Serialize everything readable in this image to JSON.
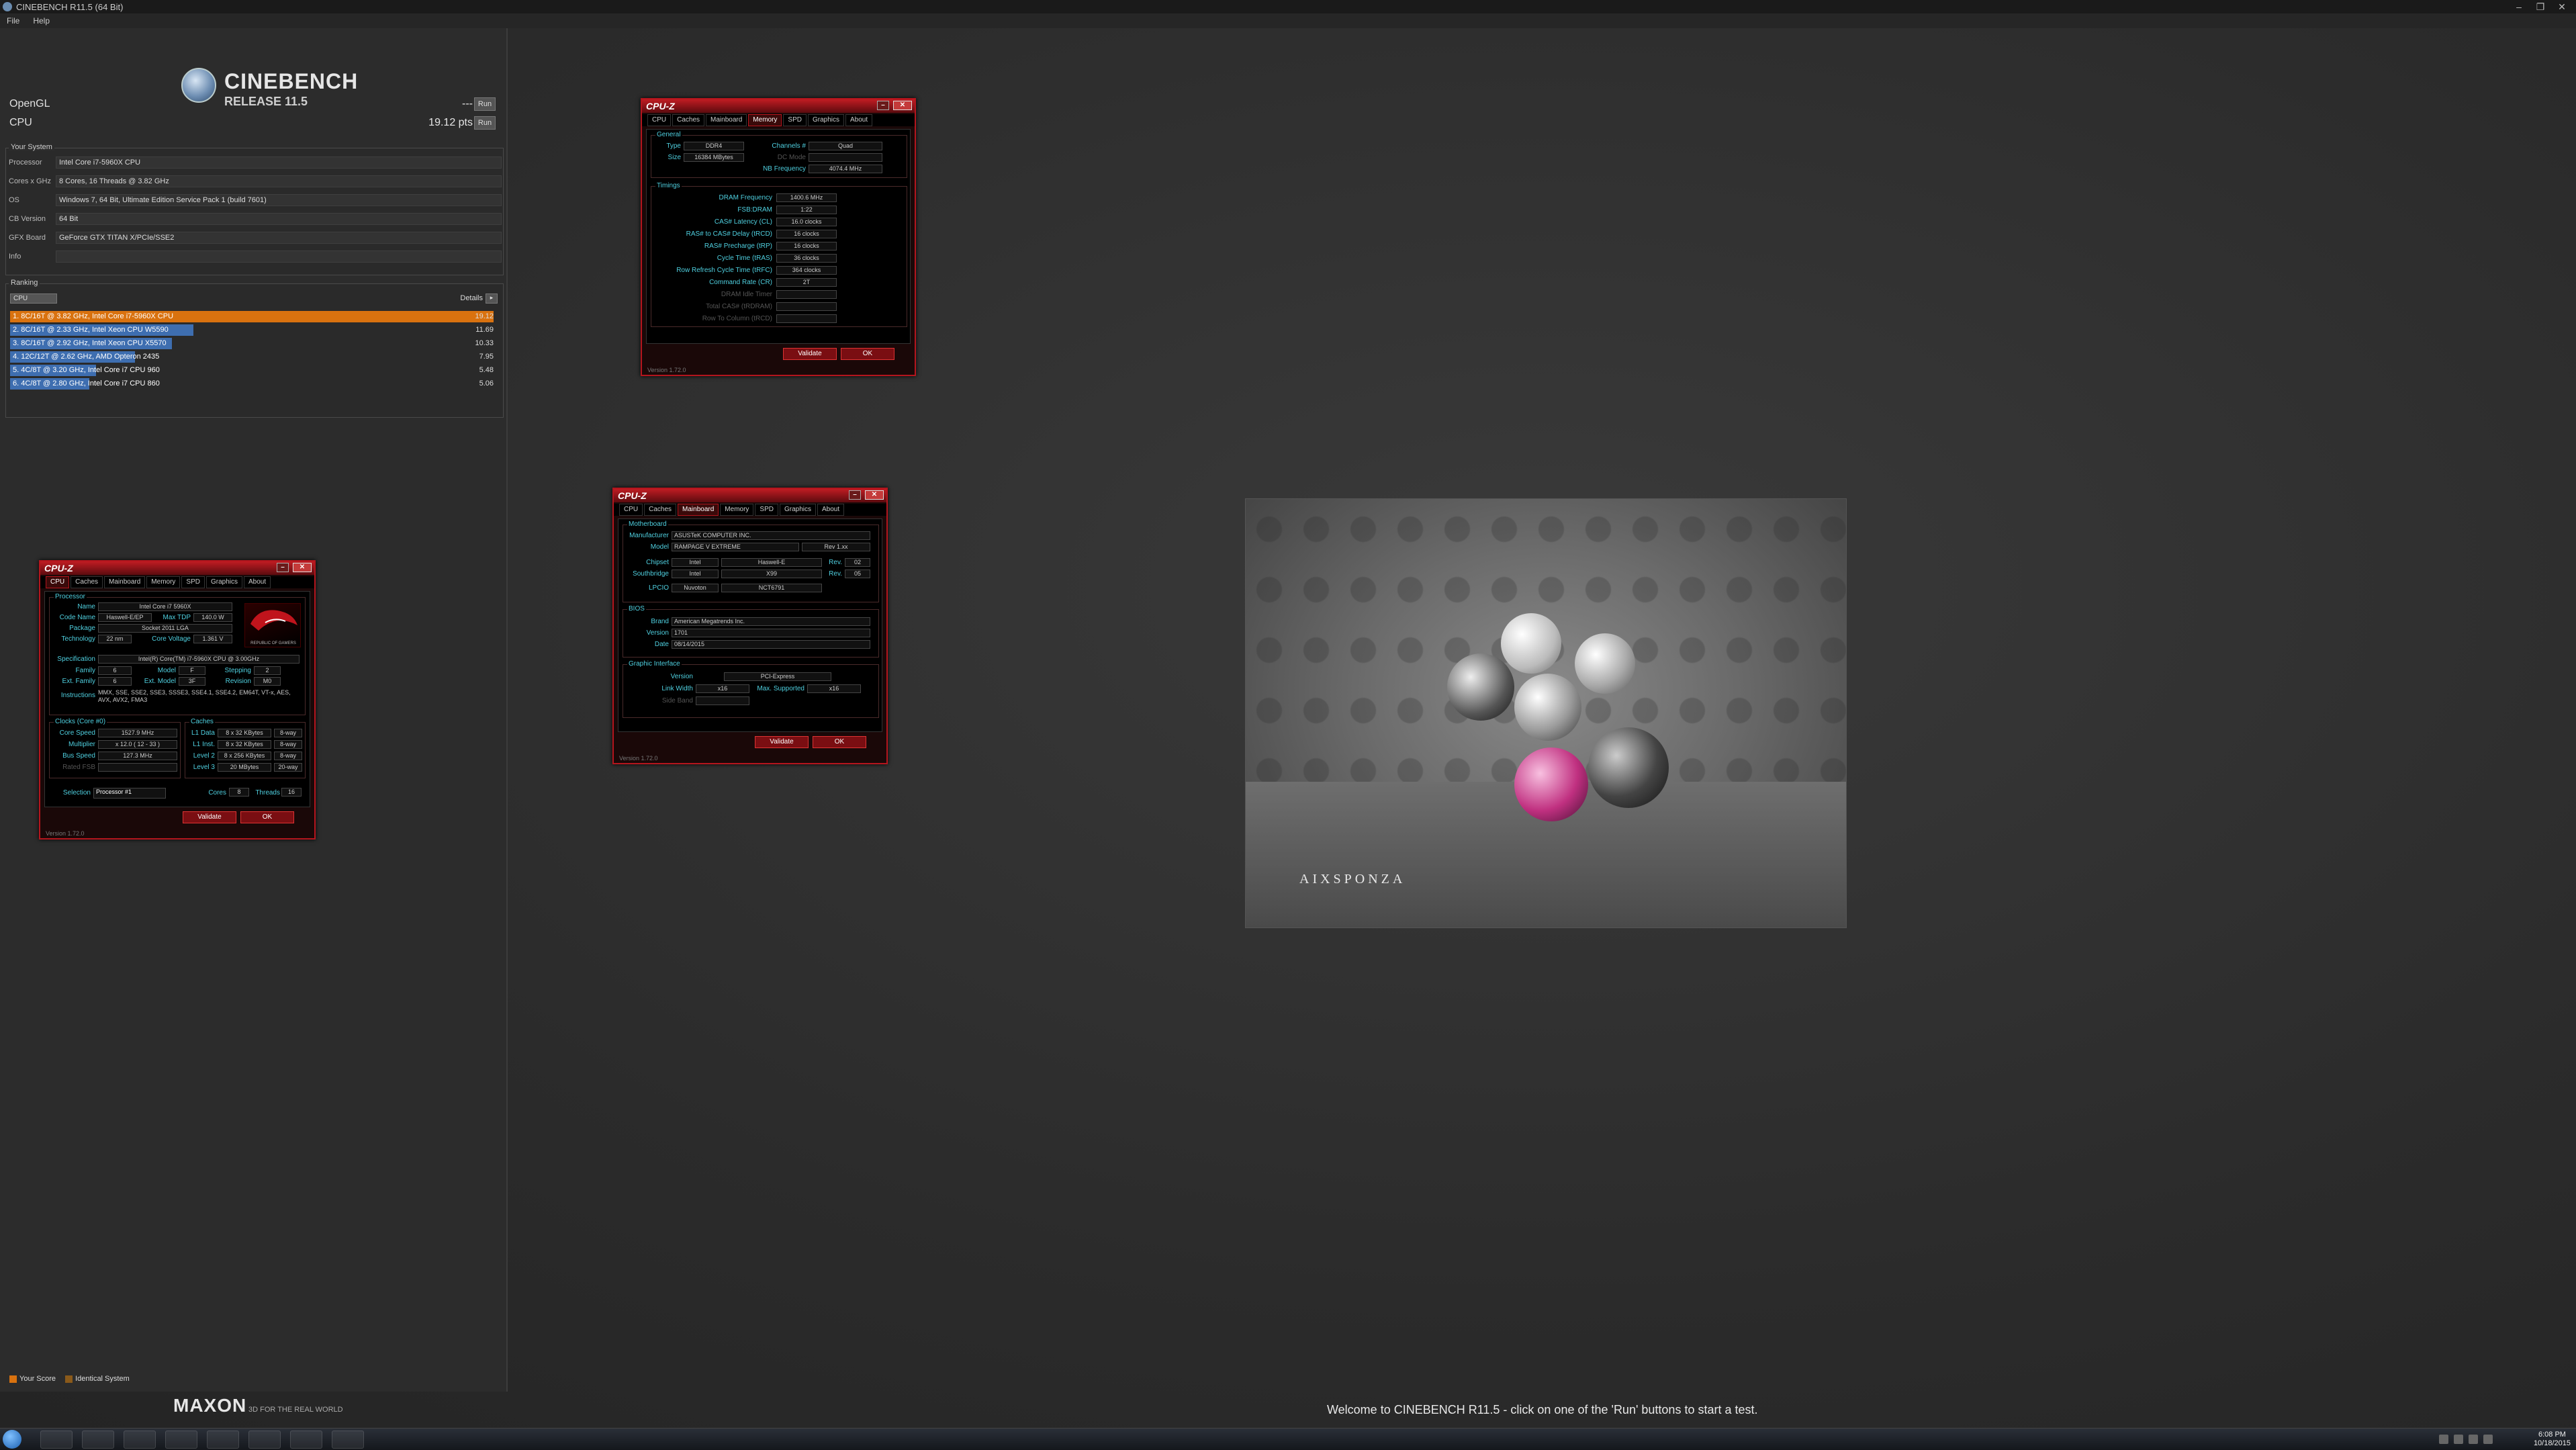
{
  "window": {
    "title": "CINEBENCH R11.5 (64 Bit)",
    "min": "–",
    "max": "❐",
    "close": "✕"
  },
  "menu": {
    "file": "File",
    "help": "Help"
  },
  "logo": {
    "name": "CINEBENCH",
    "release": "RELEASE 11.5"
  },
  "scores": {
    "opengl_label": "OpenGL",
    "opengl_value": "---",
    "opengl_run": "Run",
    "cpu_label": "CPU",
    "cpu_value": "19.12 pts",
    "cpu_run": "Run"
  },
  "your_system": {
    "header": "Your System",
    "rows": [
      {
        "k": "Processor",
        "v": "Intel Core i7-5960X CPU"
      },
      {
        "k": "Cores x GHz",
        "v": "8 Cores, 16 Threads @ 3.82 GHz"
      },
      {
        "k": "OS",
        "v": "Windows 7, 64 Bit, Ultimate Edition Service Pack 1 (build 7601)"
      },
      {
        "k": "CB Version",
        "v": "64 Bit"
      },
      {
        "k": "GFX Board",
        "v": "GeForce GTX TITAN X/PCIe/SSE2"
      },
      {
        "k": "Info",
        "v": ""
      }
    ]
  },
  "ranking": {
    "header": "Ranking",
    "filter": "CPU",
    "details": "Details",
    "entries": [
      {
        "label": "1. 8C/16T @ 3.82 GHz, Intel Core i7-5960X CPU",
        "score": "19.12",
        "frac": 1.0,
        "color": "#d9720f"
      },
      {
        "label": "2. 8C/16T @ 2.33 GHz, Intel Xeon CPU W5590",
        "score": "11.69",
        "frac": 0.611,
        "color": "#3e6eb0"
      },
      {
        "label": "3. 8C/16T @ 2.92 GHz, Intel Xeon CPU X5570",
        "score": "10.33",
        "frac": 0.54,
        "color": "#3e6eb0"
      },
      {
        "label": "4. 12C/12T @ 2.62 GHz, AMD Opteron 2435",
        "score": "7.95",
        "frac": 0.416,
        "color": "#3e6eb0"
      },
      {
        "label": "5. 4C/8T @ 3.20 GHz, Intel Core i7 CPU 960",
        "score": "5.48",
        "frac": 0.287,
        "color": "#3e6eb0"
      },
      {
        "label": "6. 4C/8T @ 2.80 GHz, Intel Core i7 CPU 860",
        "score": "5.06",
        "frac": 0.265,
        "color": "#3e6eb0"
      }
    ]
  },
  "legend": {
    "your_score": "Your Score",
    "identical": "Identical System",
    "your_color": "#d9720f",
    "identical_color": "#8a5a1a"
  },
  "footer": {
    "maxon": "MAXON",
    "tagline": "3D FOR THE REAL WORLD",
    "status": "Welcome to CINEBENCH R11.5 - click on one of the 'Run' buttons to start a test."
  },
  "render": {
    "brand": "AIXSPONZA"
  },
  "cpuz_memory": {
    "title": "CPU-Z",
    "tabs": [
      "CPU",
      "Caches",
      "Mainboard",
      "Memory",
      "SPD",
      "Graphics",
      "About"
    ],
    "general": "General",
    "type_k": "Type",
    "type_v": "DDR4",
    "size_k": "Size",
    "size_v": "16384 MBytes",
    "channels_k": "Channels #",
    "channels_v": "Quad",
    "dc_k": "DC Mode",
    "nb_k": "NB Frequency",
    "nb_v": "4074.4 MHz",
    "timings": "Timings",
    "rows": [
      {
        "k": "DRAM Frequency",
        "v": "1400.6 MHz"
      },
      {
        "k": "FSB:DRAM",
        "v": "1:22"
      },
      {
        "k": "CAS# Latency (CL)",
        "v": "16.0 clocks"
      },
      {
        "k": "RAS# to CAS# Delay (tRCD)",
        "v": "16 clocks"
      },
      {
        "k": "RAS# Precharge (tRP)",
        "v": "16 clocks"
      },
      {
        "k": "Cycle Time (tRAS)",
        "v": "36 clocks"
      },
      {
        "k": "Row Refresh Cycle Time (tRFC)",
        "v": "364 clocks"
      },
      {
        "k": "Command Rate (CR)",
        "v": "2T"
      },
      {
        "k": "DRAM Idle Timer",
        "v": ""
      },
      {
        "k": "Total CAS# (tRDRAM)",
        "v": ""
      },
      {
        "k": "Row To Column (tRCD)",
        "v": ""
      }
    ],
    "validate": "Validate",
    "ok": "OK",
    "version": "Version 1.72.0"
  },
  "cpuz_mainboard": {
    "title": "CPU-Z",
    "tabs": [
      "CPU",
      "Caches",
      "Mainboard",
      "Memory",
      "SPD",
      "Graphics",
      "About"
    ],
    "motherboard": "Motherboard",
    "manufacturer_k": "Manufacturer",
    "manufacturer_v": "ASUSTeK COMPUTER INC.",
    "model_k": "Model",
    "model_v": "RAMPAGE V EXTREME",
    "model_rev": "Rev 1.xx",
    "chipset_k": "Chipset",
    "chipset_v1": "Intel",
    "chipset_v2": "Haswell-E",
    "chipset_rev_k": "Rev.",
    "chipset_rev": "02",
    "south_k": "Southbridge",
    "south_v1": "Intel",
    "south_v2": "X99",
    "south_rev_k": "Rev.",
    "south_rev": "05",
    "lpcio_k": "LPCIO",
    "lpcio_v1": "Nuvoton",
    "lpcio_v2": "NCT6791",
    "bios": "BIOS",
    "brand_k": "Brand",
    "brand_v": "American Megatrends Inc.",
    "version_k": "Version",
    "version_v": "1701",
    "date_k": "Date",
    "date_v": "08/14/2015",
    "graphic": "Graphic Interface",
    "gversion_k": "Version",
    "gversion_v": "PCI-Express",
    "link_k": "Link Width",
    "link_v": "x16",
    "max_k": "Max. Supported",
    "max_v": "x16",
    "side_k": "Side Band",
    "validate": "Validate",
    "ok": "OK",
    "version": "Version 1.72.0"
  },
  "cpuz_cpu": {
    "title": "CPU-Z",
    "tabs": [
      "CPU",
      "Caches",
      "Mainboard",
      "Memory",
      "SPD",
      "Graphics",
      "About"
    ],
    "processor": "Processor",
    "name_k": "Name",
    "name_v": "Intel Core i7 5960X",
    "code_k": "Code Name",
    "code_v": "Haswell-E/EP",
    "tdp_k": "Max TDP",
    "tdp_v": "140.0 W",
    "package_k": "Package",
    "package_v": "Socket 2011 LGA",
    "tech_k": "Technology",
    "tech_v": "22 nm",
    "volt_k": "Core Voltage",
    "volt_v": "1.361 V",
    "spec_k": "Specification",
    "spec_v": "Intel(R) Core(TM) i7-5960X CPU @ 3.00GHz",
    "family_k": "Family",
    "family_v": "6",
    "model_k": "Model",
    "model_v": "F",
    "step_k": "Stepping",
    "step_v": "2",
    "extfam_k": "Ext. Family",
    "extfam_v": "6",
    "extmod_k": "Ext. Model",
    "extmod_v": "3F",
    "rev_k": "Revision",
    "rev_v": "M0",
    "instr_k": "Instructions",
    "instr_v": "MMX, SSE, SSE2, SSE3, SSSE3, SSE4.1, SSE4.2, EM64T, VT-x, AES, AVX, AVX2, FMA3",
    "clocks": "Clocks (Core #0)",
    "corespeed_k": "Core Speed",
    "corespeed_v": "1527.9 MHz",
    "mult_k": "Multiplier",
    "mult_v": "x 12.0 ( 12 - 33 )",
    "bus_k": "Bus Speed",
    "bus_v": "127.3 MHz",
    "fsb_k": "Rated FSB",
    "caches": "Caches",
    "l1d_k": "L1 Data",
    "l1d_v": "8 x 32 KBytes",
    "l1d_w": "8-way",
    "l1i_k": "L1 Inst.",
    "l1i_v": "8 x 32 KBytes",
    "l1i_w": "8-way",
    "l2_k": "Level 2",
    "l2_v": "8 x 256 KBytes",
    "l2_w": "8-way",
    "l3_k": "Level 3",
    "l3_v": "20 MBytes",
    "l3_w": "20-way",
    "sel_k": "Selection",
    "sel_v": "Processor #1",
    "cores_k": "Cores",
    "cores_v": "8",
    "threads_k": "Threads",
    "threads_v": "16",
    "rog": "REPUBLIC OF GAMERS",
    "validate": "Validate",
    "ok": "OK",
    "version": "Version 1.72.0"
  },
  "taskbar": {
    "time": "6:08 PM",
    "date": "10/18/2015"
  }
}
